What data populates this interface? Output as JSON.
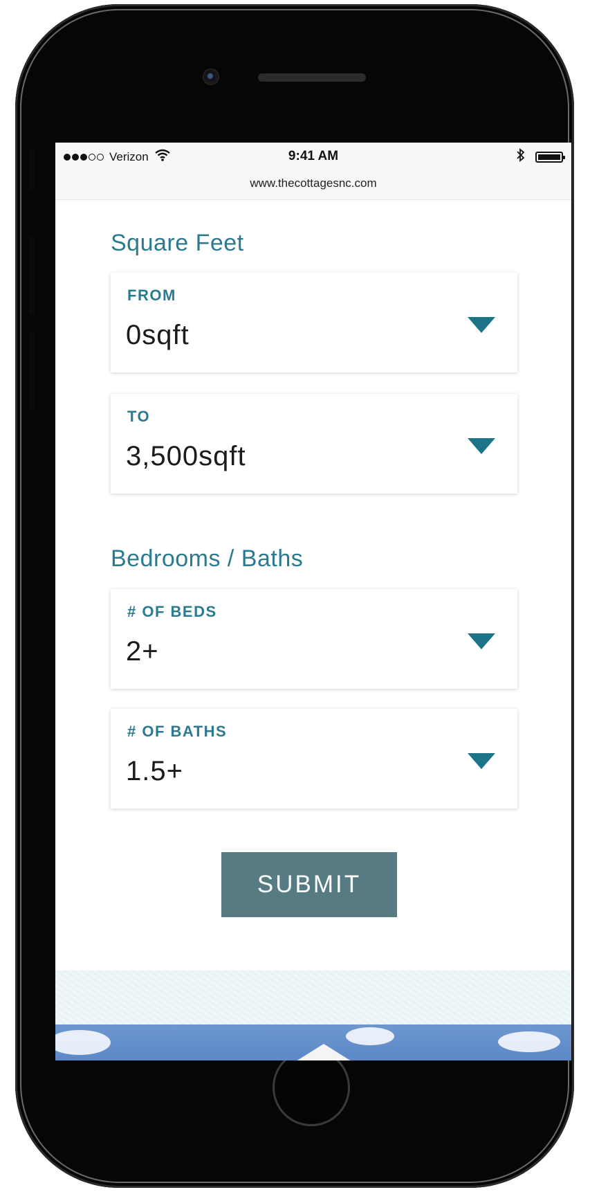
{
  "status_bar": {
    "carrier": "Verizon",
    "time": "9:41 AM",
    "url": "www.thecottagesnc.com",
    "signal_icon": "signal-dots-icon",
    "wifi_icon": "wifi-icon",
    "bluetooth_icon": "bluetooth-icon",
    "battery_icon": "battery-icon",
    "battery_level": 1.0
  },
  "square_feet": {
    "title": "Square Feet",
    "from": {
      "label": "FROM",
      "value": "0sqft"
    },
    "to": {
      "label": "TO",
      "value": "3,500sqft"
    }
  },
  "bedrooms_baths": {
    "title": "Bedrooms / Baths",
    "beds": {
      "label": "# OF BEDS",
      "value": "2+"
    },
    "baths": {
      "label": "# OF BATHS",
      "value": "1.5+"
    }
  },
  "submit_label": "SUBMIT",
  "icons": {
    "dropdown": "caret-down-icon"
  },
  "colors": {
    "accent": "#2b7a8e",
    "caret": "#1c7489",
    "button": "#567b82"
  }
}
